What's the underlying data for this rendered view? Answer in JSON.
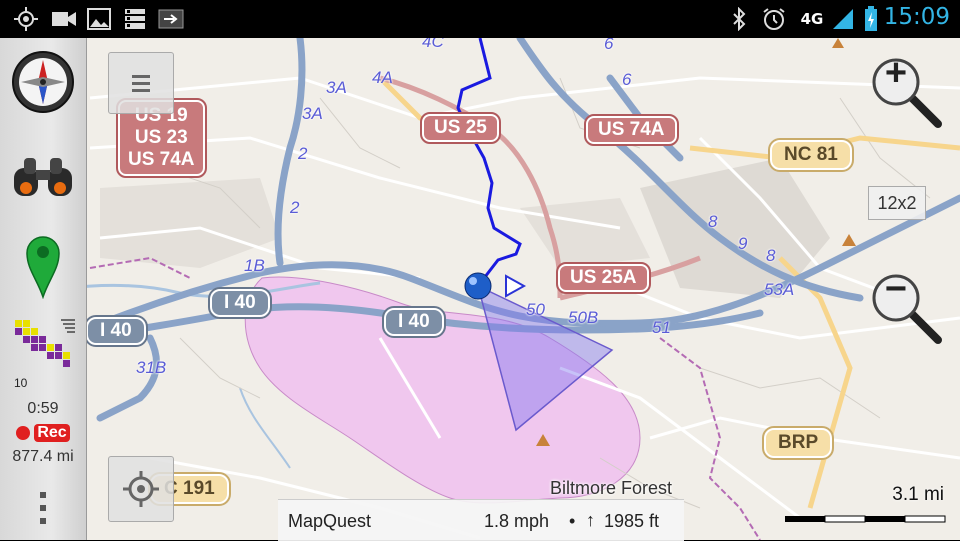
{
  "status_bar": {
    "time": "15:09",
    "network": "4G",
    "left_icons": [
      "gps-icon",
      "video-camera-icon",
      "image-icon",
      "storage-icon",
      "usb-arrow-icon"
    ],
    "right_icons": [
      "bluetooth-icon",
      "alarm-icon",
      "4g-icon",
      "signal-icon",
      "battery-charging-icon"
    ]
  },
  "sidebar": {
    "track_time": "0:59",
    "rec_label": "Rec",
    "distance": "877.4 mi",
    "level_label": "10",
    "icons": [
      "compass-icon",
      "binoculars-icon",
      "map-pin-icon",
      "tile-grid-icon",
      "menu-dots-icon"
    ]
  },
  "map": {
    "zoom_in_label": "+",
    "zoom_out_label": "−",
    "zoom_level_badge": "12x2",
    "menu_icon": "menu-icon",
    "center_button_icon": "crosshair-icon",
    "shields": {
      "us_stack": [
        "US 19",
        "US 23",
        "US 74A"
      ],
      "us25": "US 25",
      "us74a": "US 74A",
      "us25a": "US 25A",
      "nc81": "NC 81",
      "brp": "BRP",
      "nc191": "C 191",
      "i40_a": "I 40",
      "i40_b": "I 40",
      "i40_c": "I 40"
    },
    "exits": [
      "4C",
      "4A",
      "3A",
      "3A",
      "2",
      "2",
      "1B",
      "31B",
      "6",
      "6",
      "8",
      "9",
      "8",
      "53A",
      "50",
      "50B",
      "51"
    ],
    "place_label": "Biltmore Forest",
    "scale": "3.1 mi"
  },
  "bottom_bar": {
    "provider": "MapQuest",
    "speed": "1.8 mph",
    "separator": "•",
    "altitude_arrow": "↑",
    "altitude": "1985 ft"
  },
  "colors": {
    "track": "#1a1ae0",
    "park": "#f0c7ee",
    "highway": "#8aa3c8",
    "clock": "#33b5e5",
    "rec": "#e02020"
  }
}
